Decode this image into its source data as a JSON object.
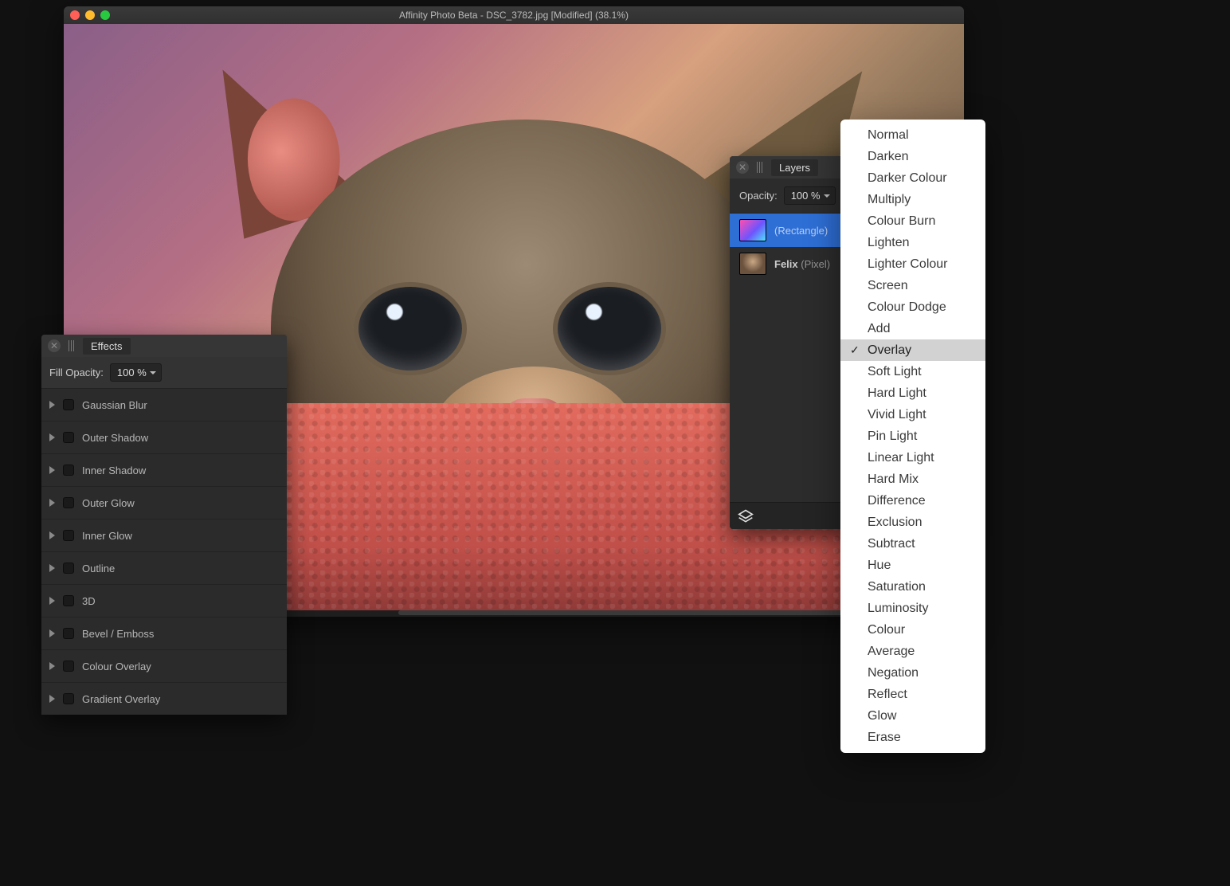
{
  "app": {
    "title": "Affinity Photo Beta - DSC_3782.jpg [Modified] (38.1%)"
  },
  "effects": {
    "panel_title": "Effects",
    "fill_label": "Fill Opacity:",
    "fill_value": "100 %",
    "items": [
      "Gaussian Blur",
      "Outer Shadow",
      "Inner Shadow",
      "Outer Glow",
      "Inner Glow",
      "Outline",
      "3D",
      "Bevel / Emboss",
      "Colour Overlay",
      "Gradient Overlay"
    ]
  },
  "layers": {
    "panel_title": "Layers",
    "opacity_label": "Opacity:",
    "opacity_value": "100 %",
    "items": [
      {
        "name": "",
        "type": "(Rectangle)",
        "selected": true,
        "thumb": "grad"
      },
      {
        "name": "Felix",
        "type": "(Pixel)",
        "selected": false,
        "thumb": "img"
      }
    ]
  },
  "blend_modes": {
    "selected": "Overlay",
    "items": [
      "Normal",
      "Darken",
      "Darker Colour",
      "Multiply",
      "Colour Burn",
      "Lighten",
      "Lighter Colour",
      "Screen",
      "Colour Dodge",
      "Add",
      "Overlay",
      "Soft Light",
      "Hard Light",
      "Vivid Light",
      "Pin Light",
      "Linear Light",
      "Hard Mix",
      "Difference",
      "Exclusion",
      "Subtract",
      "Hue",
      "Saturation",
      "Luminosity",
      "Colour",
      "Average",
      "Negation",
      "Reflect",
      "Glow",
      "Erase"
    ]
  }
}
